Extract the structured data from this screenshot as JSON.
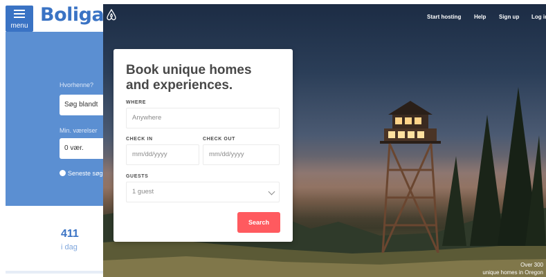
{
  "boliga": {
    "menu_label": "menu",
    "logo": "Boliga",
    "where_label": "Hvorhenne?",
    "search_placeholder": "Søg blandt",
    "min_label": "Min. værelser",
    "min_value": "0 vær.",
    "recent_label": "Seneste søgninger",
    "listing_count": "411",
    "listing_period": "i dag",
    "brand_color": "#3a73c4"
  },
  "airbnb": {
    "nav": {
      "start_hosting": "Start hosting",
      "help": "Help",
      "sign_up": "Sign up",
      "log_in": "Log in"
    },
    "card": {
      "title": "Book unique homes and experiences.",
      "where_label": "WHERE",
      "where_placeholder": "Anywhere",
      "checkin_label": "CHECK IN",
      "checkin_placeholder": "mm/dd/yyyy",
      "checkout_label": "CHECK OUT",
      "checkout_placeholder": "mm/dd/yyyy",
      "guests_label": "GUESTS",
      "guests_value": "1 guest",
      "search_button": "Search"
    },
    "caption_line1": "Over 300",
    "caption_line2": "unique homes in Oregon",
    "accent_color": "#ff5a5f",
    "icons": [
      "airbnb-logo-icon",
      "chevron-down-icon",
      "clock-icon",
      "hamburger-menu-icon"
    ]
  }
}
